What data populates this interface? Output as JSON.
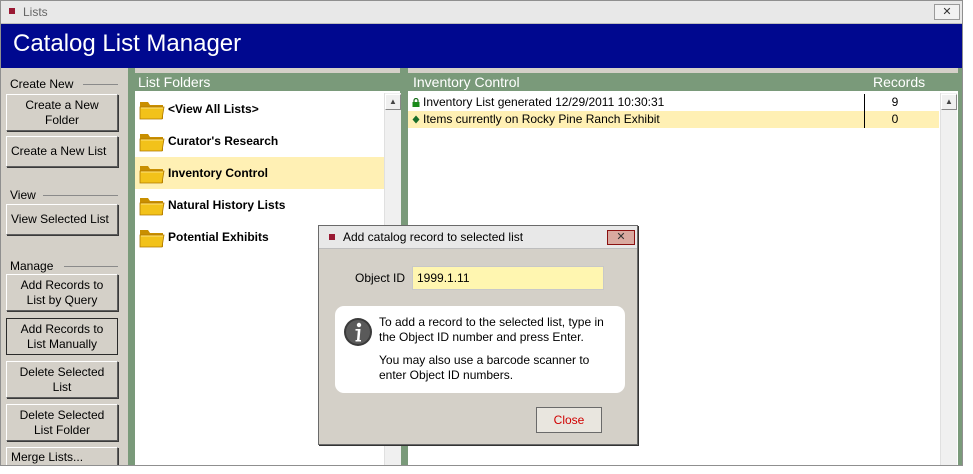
{
  "window": {
    "title": "Lists",
    "close_glyph": "✕"
  },
  "header": {
    "title": "Catalog List Manager"
  },
  "left_panel": {
    "sections": {
      "create_new": "Create New",
      "view": "View",
      "manage": "Manage"
    },
    "buttons": {
      "create_folder": "Create a New Folder",
      "create_list": "Create a New List",
      "view_selected": "View Selected List",
      "add_by_query": "Add Records to List by Query",
      "add_manually": "Add Records to List Manually",
      "delete_list": "Delete Selected List",
      "delete_folder": "Delete Selected List Folder",
      "merge_lists": "Merge Lists..."
    }
  },
  "folders": {
    "header": "List Folders",
    "items": [
      {
        "label": "<View All Lists>",
        "icon": "folder-icon"
      },
      {
        "label": "Curator's Research",
        "icon": "folder-icon"
      },
      {
        "label": "Inventory Control",
        "icon": "folder-icon",
        "selected": true
      },
      {
        "label": "Natural History Lists",
        "icon": "folder-icon"
      },
      {
        "label": "Potential Exhibits",
        "icon": "folder-icon"
      }
    ]
  },
  "inventory": {
    "header": "Inventory Control",
    "records_header": "Records",
    "rows": [
      {
        "name": "Inventory List generated 12/29/2011 10:30:31",
        "records": "9",
        "icon": "lock-icon"
      },
      {
        "name": "Items currently on Rocky Pine Ranch Exhibit",
        "records": "0",
        "icon": "diamond-icon",
        "selected": true
      }
    ]
  },
  "dialog": {
    "title": "Add catalog record to selected list",
    "object_id_label": "Object ID",
    "object_id_value": "1999.1.11",
    "info_line1": "To add a record to the selected list, type in the Object ID number and press Enter.",
    "info_line2": "You may also use a barcode scanner to enter Object ID numbers.",
    "close_button": "Close",
    "close_glyph": "✕"
  },
  "colors": {
    "header_bg": "#00088f",
    "panel_header_bg": "#7a9a7a",
    "selection_bg": "#fff0b4",
    "input_bg": "#fff6b0",
    "close_text": "#d00000"
  }
}
